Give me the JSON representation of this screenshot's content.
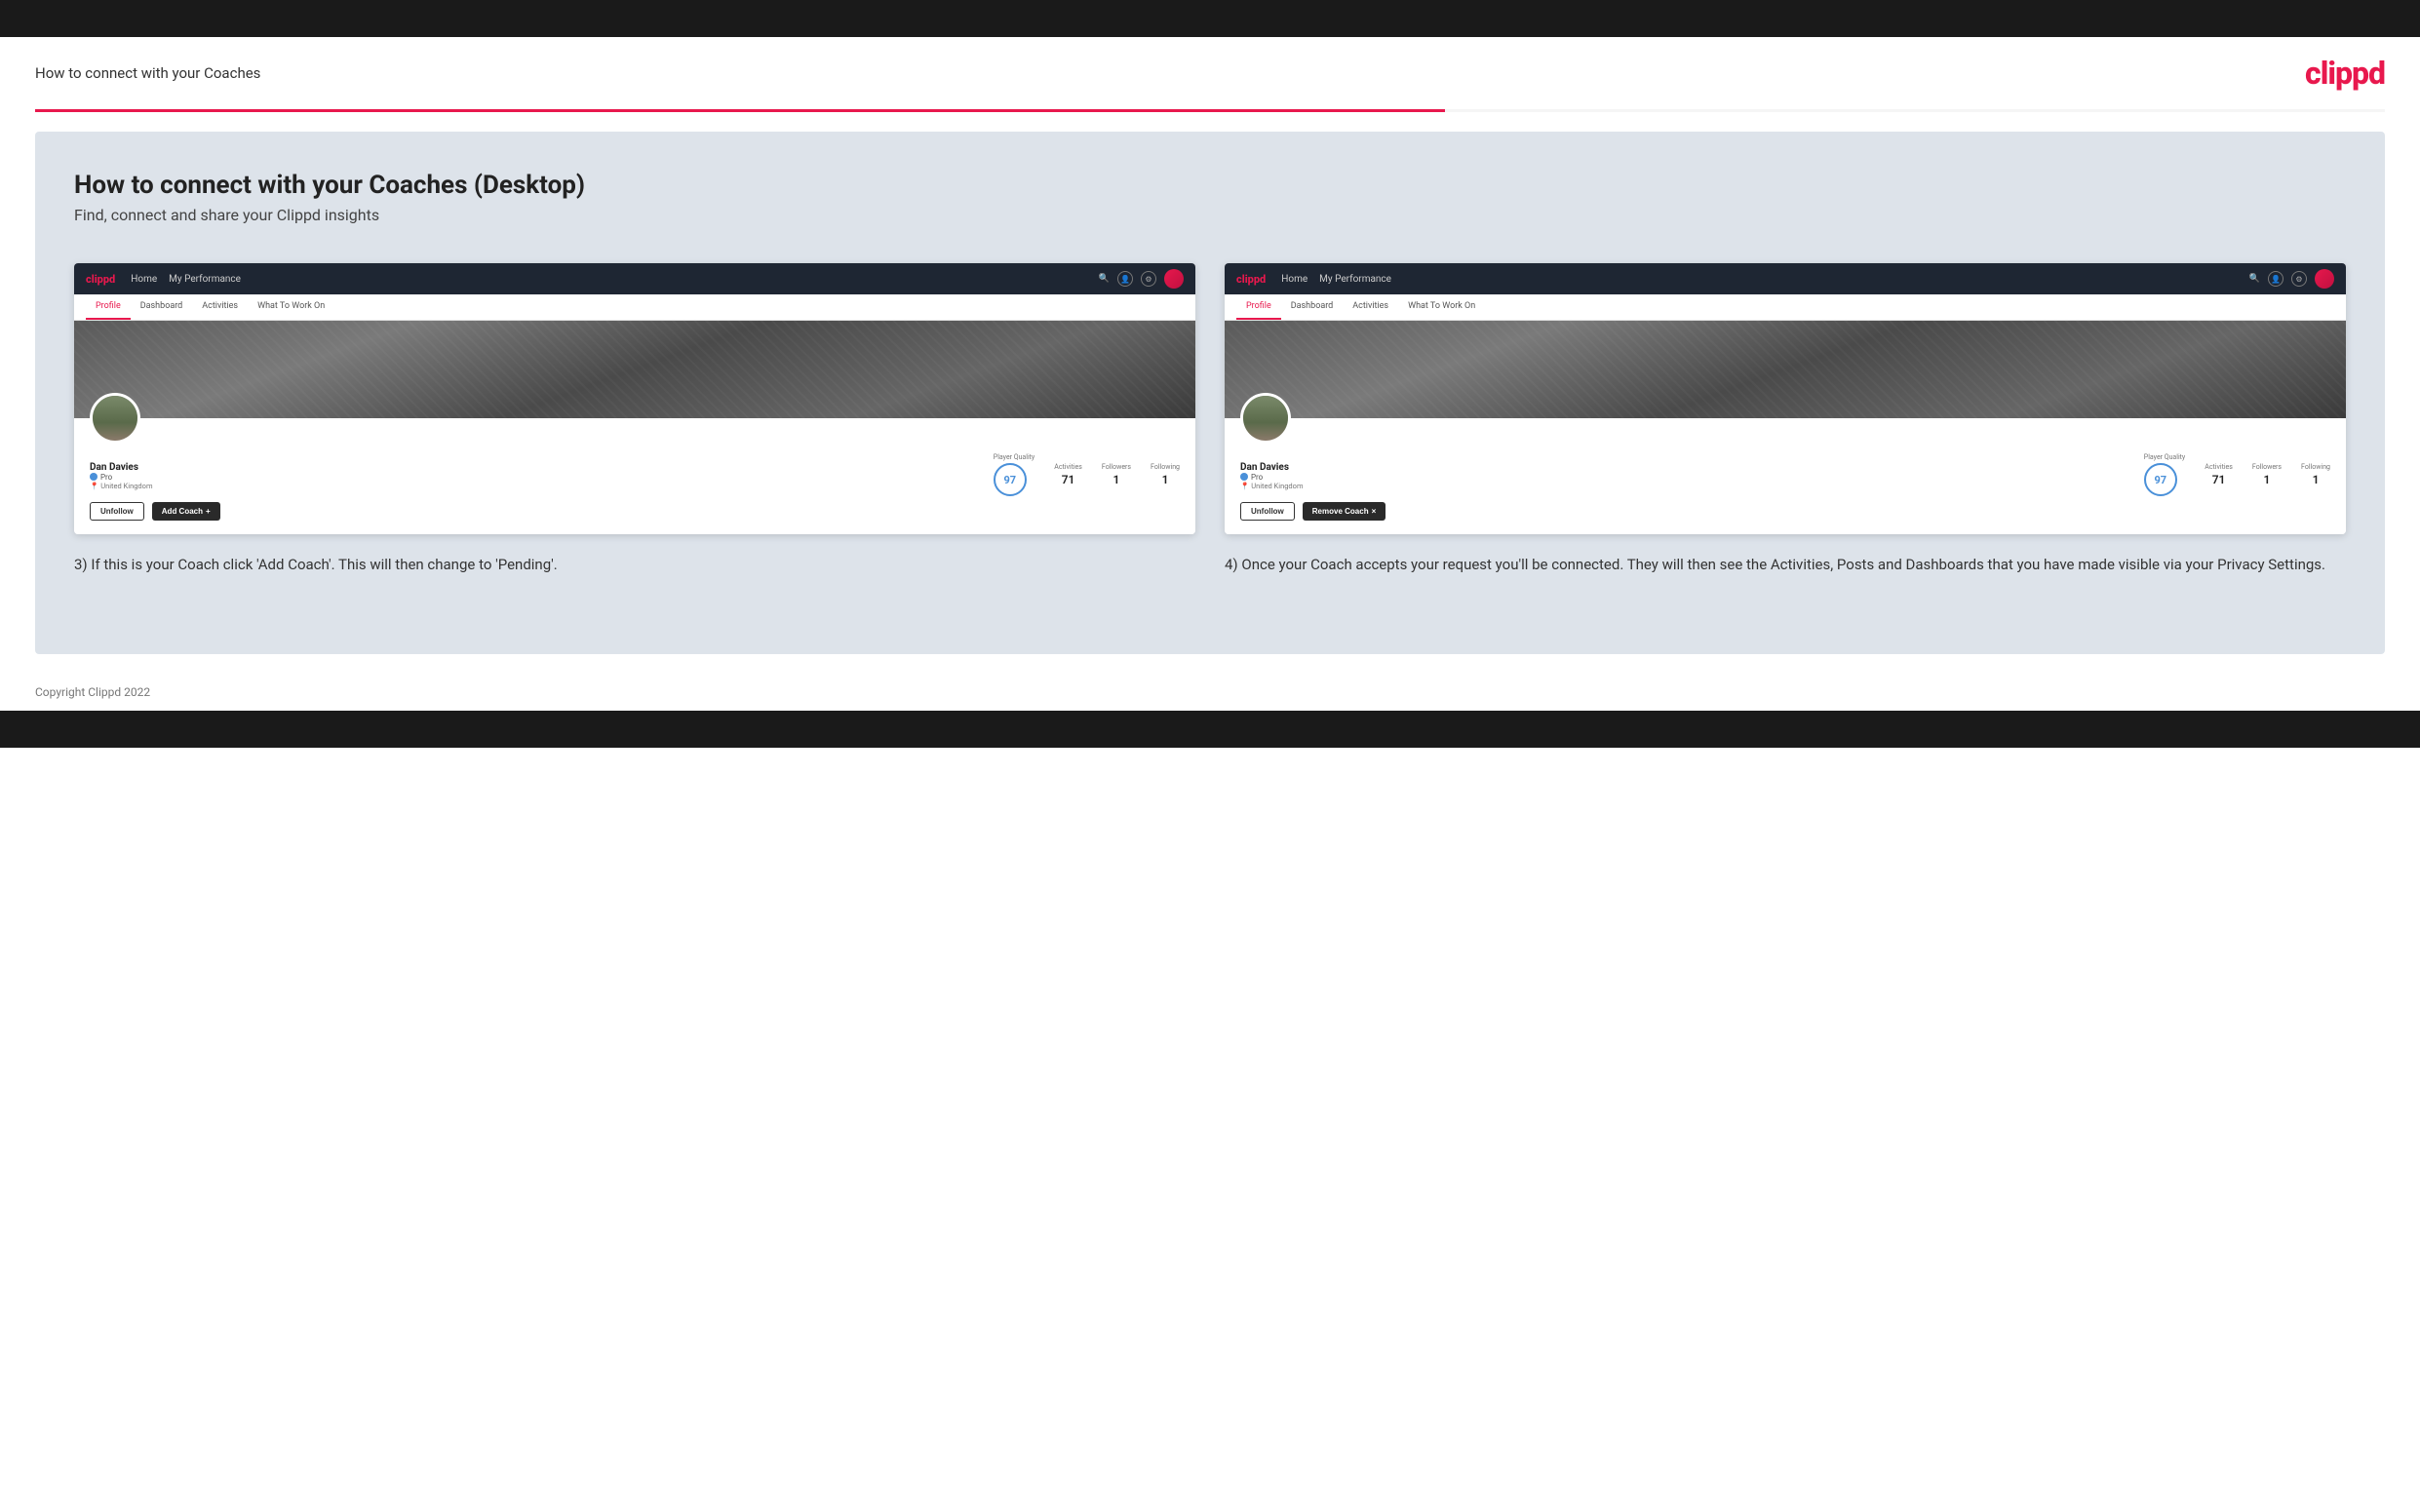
{
  "page": {
    "top_bar_visible": true,
    "header_title": "How to connect with your Coaches",
    "logo_text": "clippd",
    "divider_visible": true
  },
  "main": {
    "heading": "How to connect with your Coaches (Desktop)",
    "subheading": "Find, connect and share your Clippd insights",
    "screenshot_left": {
      "nav": {
        "logo": "clippd",
        "links": [
          "Home",
          "My Performance"
        ],
        "icons": [
          "search",
          "user",
          "settings",
          "avatar"
        ]
      },
      "tabs": [
        "Profile",
        "Dashboard",
        "Activities",
        "What To Work On"
      ],
      "active_tab": "Profile",
      "profile": {
        "player_name": "Dan Davies",
        "badge": "Pro",
        "location": "United Kingdom",
        "quality_score": "97",
        "stats": {
          "player_quality_label": "Player Quality",
          "activities_label": "Activities",
          "activities_value": "71",
          "followers_label": "Followers",
          "followers_value": "1",
          "following_label": "Following",
          "following_value": "1"
        },
        "buttons": {
          "unfollow": "Unfollow",
          "add_coach": "Add Coach",
          "add_coach_icon": "+"
        }
      }
    },
    "screenshot_right": {
      "nav": {
        "logo": "clippd",
        "links": [
          "Home",
          "My Performance"
        ],
        "icons": [
          "search",
          "user",
          "settings",
          "avatar"
        ]
      },
      "tabs": [
        "Profile",
        "Dashboard",
        "Activities",
        "What To Work On"
      ],
      "active_tab": "Profile",
      "profile": {
        "player_name": "Dan Davies",
        "badge": "Pro",
        "location": "United Kingdom",
        "quality_score": "97",
        "stats": {
          "player_quality_label": "Player Quality",
          "activities_label": "Activities",
          "activities_value": "71",
          "followers_label": "Followers",
          "followers_value": "1",
          "following_label": "Following",
          "following_value": "1"
        },
        "buttons": {
          "unfollow": "Unfollow",
          "remove_coach": "Remove Coach",
          "remove_coach_icon": "×"
        }
      }
    },
    "description_left": "3) If this is your Coach click 'Add Coach'. This will then change to 'Pending'.",
    "description_right": "4) Once your Coach accepts your request you'll be connected. They will then see the Activities, Posts and Dashboards that you have made visible via your Privacy Settings."
  },
  "footer": {
    "copyright": "Copyright Clippd 2022"
  }
}
